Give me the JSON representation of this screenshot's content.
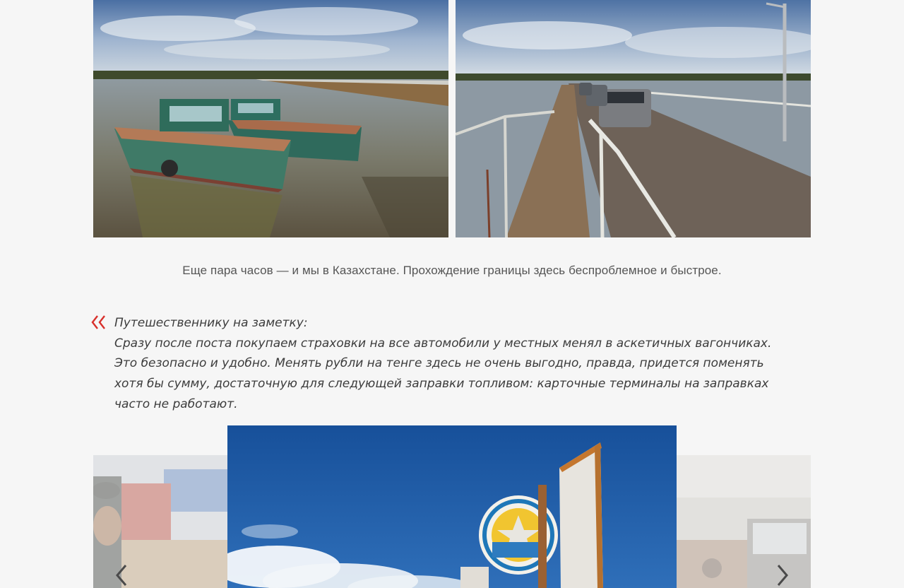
{
  "gallery_top": {
    "left_photo": {
      "name": "boats-on-river-photo"
    },
    "right_photo": {
      "name": "pontoon-bridge-photo"
    }
  },
  "caption": {
    "text": "Еще пара часов — и мы в Казахстане. Прохождение границы здесь беспроблемное и быстрое."
  },
  "note": {
    "lines": [
      "Путешественнику на заметку:",
      "Сразу после поста покупаем страховки на все автомобили у местных менял в аскетичных вагончиках.",
      "Это безопасно и удобно. Менять рубли на тенге здесь не очень выгодно, правда, придется поменять",
      "хотя бы сумму, достаточную для следующей заправки топливом: карточные терминалы на заправках",
      "часто не работают."
    ]
  },
  "carousel": {
    "prev_icon": "chevron-left-icon",
    "next_icon": "chevron-right-icon"
  },
  "colors": {
    "accent": "#d8302c",
    "background": "#f6f6f6",
    "text": "#3c3c3c",
    "caption_text": "#555555"
  }
}
